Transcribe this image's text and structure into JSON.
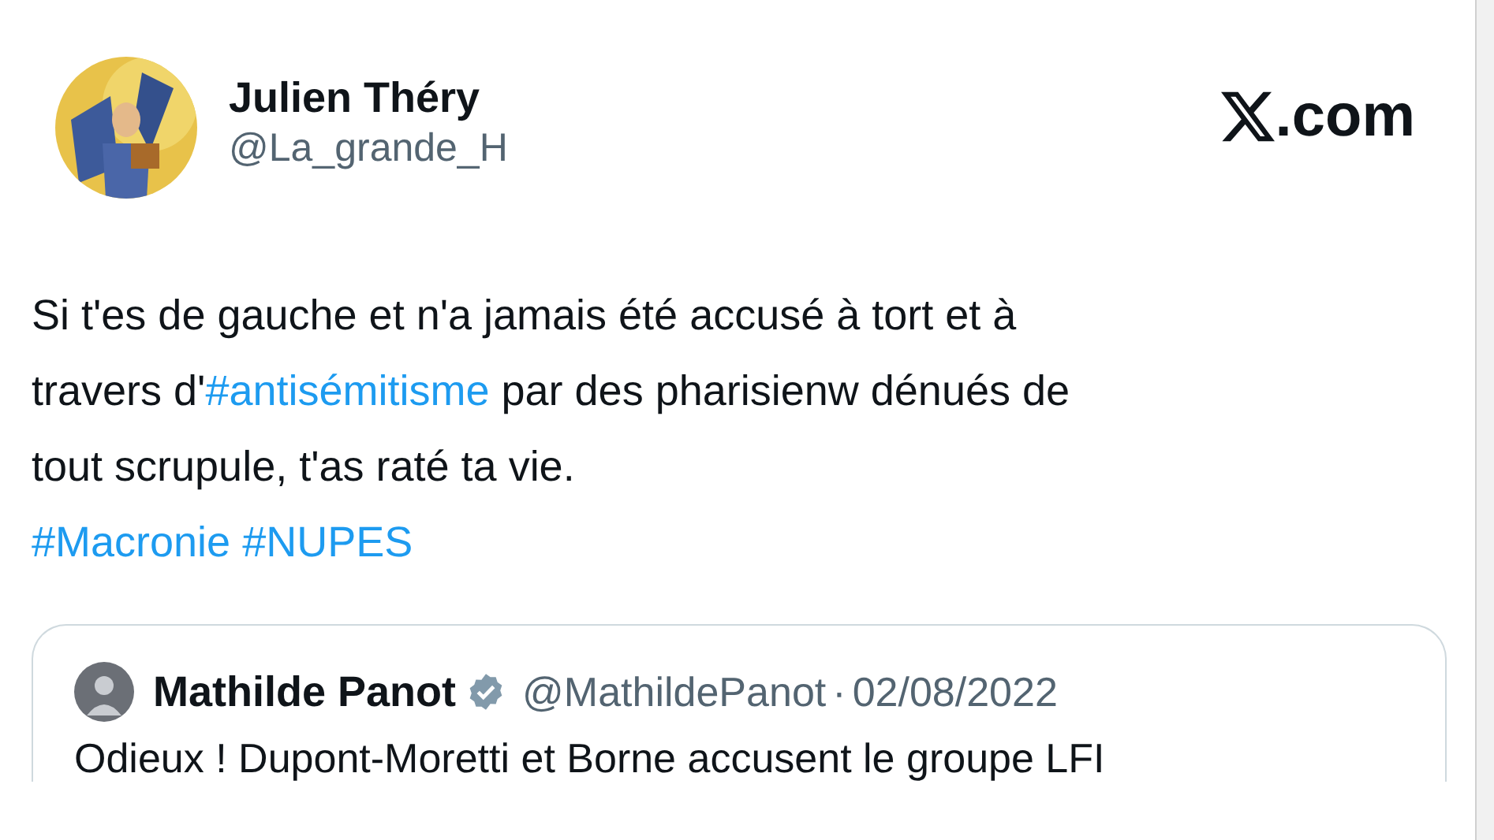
{
  "author": {
    "name": "Julien Théry",
    "handle": "@La_grande_H"
  },
  "site": {
    "suffix": ".com"
  },
  "body": [
    [
      {
        "kind": "plain",
        "text": "Si t'es de gauche et n'a jamais été accusé à tort et à"
      }
    ],
    [
      {
        "kind": "plain",
        "text": "travers d'"
      },
      {
        "kind": "hashtag",
        "text": "#antisémitisme"
      },
      {
        "kind": "plain",
        "text": " par des pharisienw dénués de"
      }
    ],
    [
      {
        "kind": "plain",
        "text": "tout scrupule, t'as raté ta vie."
      }
    ],
    [
      {
        "kind": "hashtag",
        "text": "#Macronie"
      },
      {
        "kind": "hashtag",
        "text": "#NUPES"
      }
    ]
  ],
  "quote": {
    "name": "Mathilde Panot",
    "verified": true,
    "handle": "@MathildePanot",
    "separator": "·",
    "date": "02/08/2022",
    "text": "Odieux ! Dupont-Moretti et Borne accusent le groupe LFI"
  }
}
